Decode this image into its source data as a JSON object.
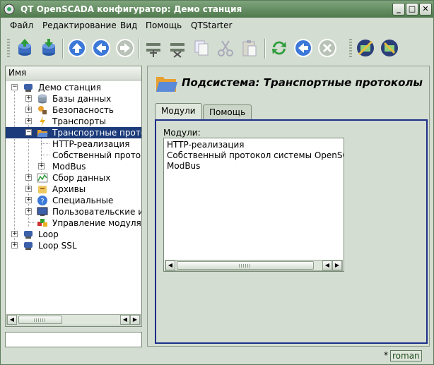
{
  "window": {
    "title": "QT OpenSCADA конфигуратор: Демо станция",
    "buttons": {
      "minimize": "_",
      "maximize": "□",
      "close": "✕"
    }
  },
  "menu": {
    "items": [
      {
        "label": "Файл"
      },
      {
        "label": "Редактирование"
      },
      {
        "label": "Вид"
      },
      {
        "label": "Помощь"
      },
      {
        "label": "QTStarter"
      }
    ]
  },
  "toolbar": {
    "icons": [
      "db-up-icon",
      "db-down-icon",
      "up-icon",
      "back-icon",
      "forward-icon",
      "add-item-icon",
      "delete-item-icon",
      "copy-icon",
      "cut-icon",
      "paste-icon",
      "refresh-icon",
      "previous-icon",
      "stop-icon",
      "tool-a-icon",
      "tool-b-icon"
    ]
  },
  "tree": {
    "header": "Имя",
    "items": [
      {
        "label": "Демо станция",
        "icon": "station-icon",
        "level": 0
      },
      {
        "label": "Базы данных",
        "icon": "database-icon",
        "level": 1
      },
      {
        "label": "Безопасность",
        "icon": "security-icon",
        "level": 1
      },
      {
        "label": "Транспорты",
        "icon": "transport-icon",
        "level": 1
      },
      {
        "label": "Транспортные протокол",
        "icon": "folder-icon",
        "level": 1,
        "selected": true
      },
      {
        "label": "HTTP-реализация",
        "level": 2
      },
      {
        "label": "Собственный протоко",
        "level": 2
      },
      {
        "label": "ModBus",
        "level": 2
      },
      {
        "label": "Сбор данных",
        "icon": "daq-icon",
        "level": 1
      },
      {
        "label": "Архивы",
        "icon": "archive-icon",
        "level": 1
      },
      {
        "label": "Специальные",
        "icon": "special-icon",
        "level": 1
      },
      {
        "label": "Пользовательские ин",
        "icon": "ui-icon",
        "level": 1
      },
      {
        "label": "Управление модулям",
        "icon": "modules-icon",
        "level": 1
      },
      {
        "label": "Loop",
        "icon": "station-icon",
        "level": 0
      },
      {
        "label": "Loop SSL",
        "icon": "station-icon",
        "level": 0
      }
    ]
  },
  "page": {
    "title": "Подсистема: Транспортные протоколы",
    "tabs": [
      {
        "label": "Модули"
      },
      {
        "label": "Помощь"
      }
    ],
    "modules_label": "Модули:",
    "modules": [
      "HTTP-реализация",
      "Собственный протокол системы OpenSCADA",
      "ModBus"
    ]
  },
  "status": {
    "modified": "*",
    "user": "roman"
  }
}
